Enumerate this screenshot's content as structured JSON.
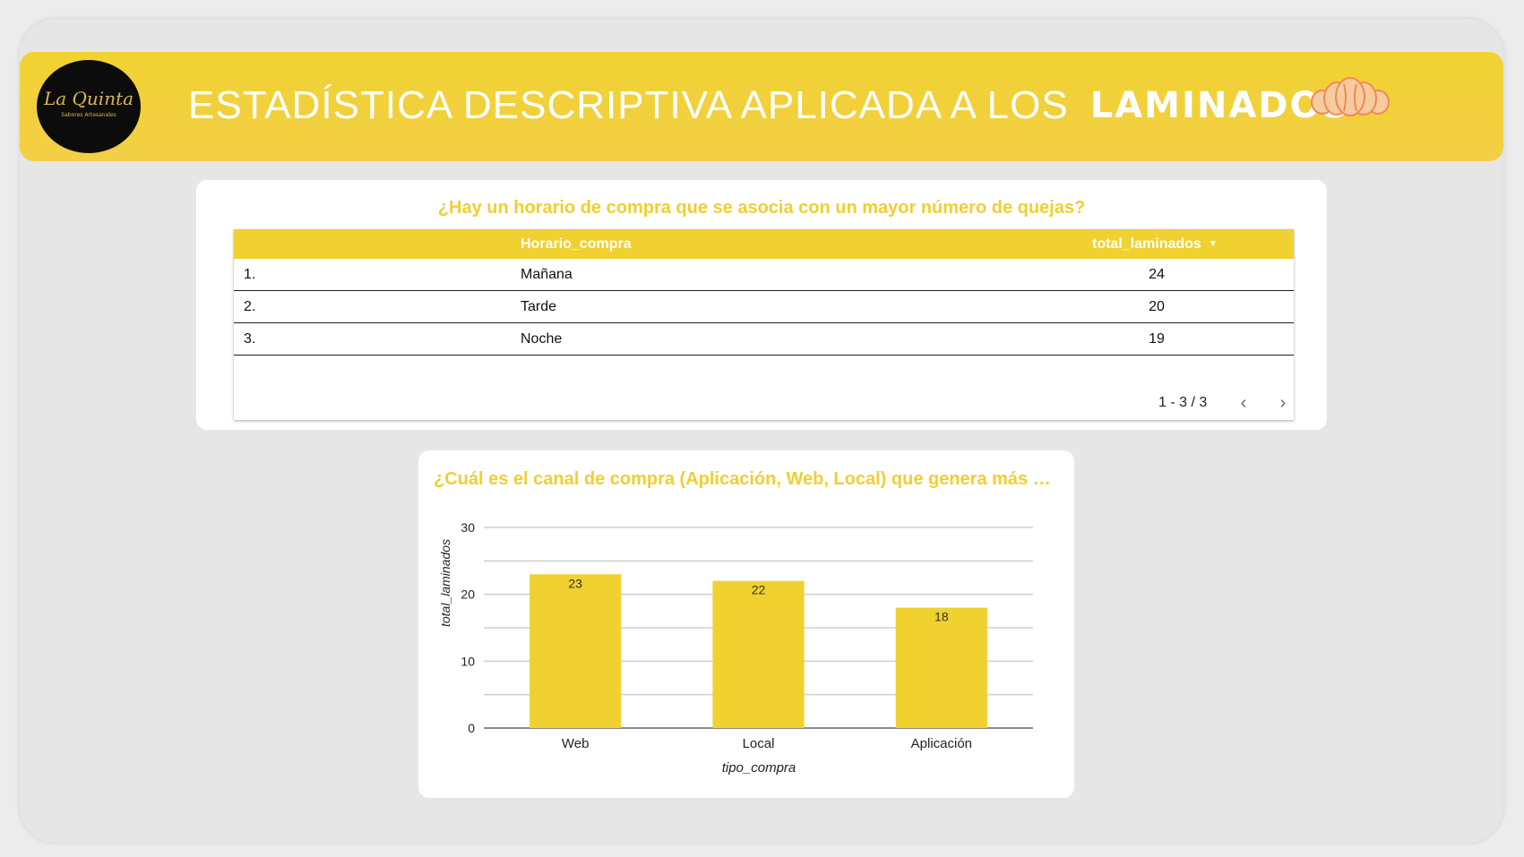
{
  "header": {
    "logo_text": "La Quinta",
    "logo_subtext": "Sabores Artesanales",
    "title_light": "ESTADÍSTICA DESCRIPTIVA APLICADA A LOS",
    "title_bold": "LAMINADOS",
    "accent_color": "#f1d232"
  },
  "table_card": {
    "title": "¿Hay un horario de compra que se asocia con un mayor número de quejas?",
    "columns": [
      "Horario_compra",
      "total_laminados"
    ],
    "sort_icon": "sort-desc-icon",
    "rows": [
      {
        "index": "1.",
        "category": "Mañana",
        "value": "24"
      },
      {
        "index": "2.",
        "category": "Tarde",
        "value": "20"
      },
      {
        "index": "3.",
        "category": "Noche",
        "value": "19"
      }
    ],
    "pager": {
      "text": "1 - 3 / 3",
      "prev_icon": "chevron-left-icon",
      "next_icon": "chevron-right-icon"
    }
  },
  "chart_card": {
    "title": "¿Cuál es el canal de compra (Aplicación, Web, Local) que genera más quejas?"
  },
  "chart_data": {
    "type": "bar",
    "title": "¿Cuál es el canal de compra (Aplicación, Web, Local) que genera más quejas?",
    "categories": [
      "Web",
      "Local",
      "Aplicación"
    ],
    "values": [
      23,
      22,
      18
    ],
    "data_labels": [
      "23",
      "22",
      "18"
    ],
    "xlabel": "tipo_compra",
    "ylabel": "total_laminados",
    "ylim": [
      0,
      30
    ],
    "yticks": [
      "0",
      "10",
      "20",
      "30"
    ],
    "gridlines": true,
    "bar_color": "#f0d130"
  }
}
